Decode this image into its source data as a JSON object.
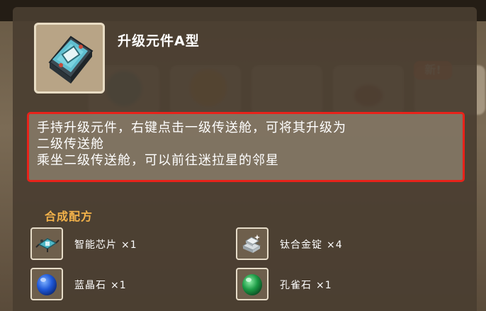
{
  "item": {
    "title": "升级元件A型",
    "icon": "upgrade-component-icon"
  },
  "description": {
    "lines": [
      "手持升级元件，右键点击一级传送舱，可将其升级为",
      "二级传送舱",
      "乘坐二级传送舱，可以前往迷拉星的邻星"
    ]
  },
  "background": {
    "new_badge": "新!"
  },
  "recipe": {
    "title": "合成配方",
    "materials": [
      {
        "name": "智能芯片",
        "count": "×1",
        "icon": "smart-chip-icon"
      },
      {
        "name": "钛合金锭",
        "count": "×4",
        "icon": "titanium-ingot-icon"
      },
      {
        "name": "蓝晶石",
        "count": "×1",
        "icon": "blue-crystal-icon"
      },
      {
        "name": "孔雀石",
        "count": "×1",
        "icon": "malachite-icon"
      }
    ]
  },
  "colors": {
    "highlight_border": "#e8221a",
    "recipe_title": "#f3b24a",
    "panel": "#4a3e31"
  }
}
